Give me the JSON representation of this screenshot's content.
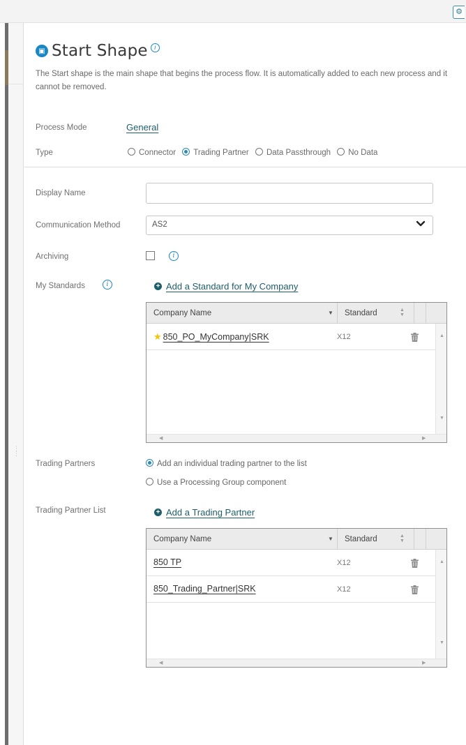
{
  "header": {
    "settings_icon": "gear-icon"
  },
  "panel": {
    "title": "Start Shape",
    "title_icon": "start-shape-icon",
    "description": "The Start shape is the main shape that begins the process flow. It is automatically added to each new process and it cannot be removed.",
    "process_mode": {
      "label": "Process Mode",
      "value": "General"
    },
    "type": {
      "label": "Type",
      "options": [
        "Connector",
        "Trading Partner",
        "Data Passthrough",
        "No Data"
      ],
      "selected": "Trading Partner"
    },
    "display_name": {
      "label": "Display Name",
      "value": ""
    },
    "communication_method": {
      "label": "Communication Method",
      "value": "AS2"
    },
    "archiving": {
      "label": "Archiving",
      "checked": false
    },
    "my_standards": {
      "label": "My Standards",
      "add_link": "Add a Standard for My Company",
      "columns": [
        "Company Name",
        "Standard"
      ],
      "rows": [
        {
          "name": "850_PO_MyCompany|SRK",
          "standard": "X12",
          "starred": true
        }
      ]
    },
    "trading_partners": {
      "label": "Trading Partners",
      "options": [
        "Add an individual trading partner to the list",
        "Use a Processing Group component"
      ],
      "selected": "Add an individual trading partner to the list"
    },
    "trading_partner_list": {
      "label": "Trading Partner List",
      "add_link": "Add a Trading Partner",
      "columns": [
        "Company Name",
        "Standard"
      ],
      "rows": [
        {
          "name": "850 TP",
          "standard": "X12"
        },
        {
          "name": "850_Trading_Partner|SRK",
          "standard": "X12"
        }
      ]
    }
  }
}
